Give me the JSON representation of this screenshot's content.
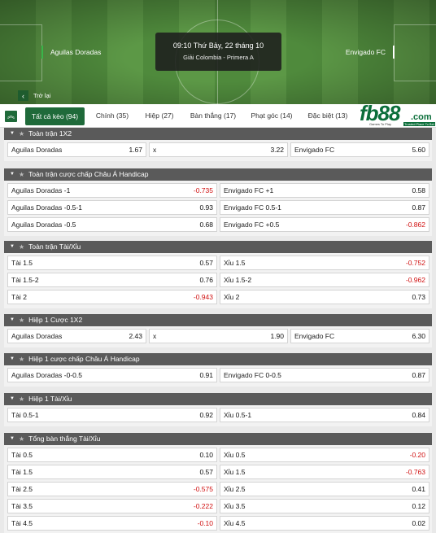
{
  "header": {
    "home_team": "Aguilas Doradas",
    "away_team": "Envigado FC",
    "time": "09:10 Thứ Bảy, 22 tháng 10",
    "league": "Giải Colombia - Primera A",
    "back_label": "Trở lại"
  },
  "tabs": [
    {
      "label": "Tất cả kèo (94)",
      "active": true
    },
    {
      "label": "Chính (35)"
    },
    {
      "label": "Hiệp (27)"
    },
    {
      "label": "Bàn thắng (17)"
    },
    {
      "label": "Phạt góc (14)"
    },
    {
      "label": "Đặc biệt (13)"
    }
  ],
  "logo": {
    "main": "fb88",
    "suffix": ".com",
    "tagline_left": "Games To Play",
    "tagline_right": "Trusted Place To Bet"
  },
  "markets": [
    {
      "title": "Toàn trận 1X2",
      "rows": [
        [
          {
            "name": "Aguilas Doradas",
            "line": "",
            "odds": "1.67"
          },
          {
            "name": "x",
            "line": "",
            "odds": "3.22"
          },
          {
            "name": "Envigado FC",
            "line": "",
            "odds": "5.60"
          }
        ]
      ]
    },
    {
      "title": "Toàn trận cược chấp Châu Á Handicap",
      "rows": [
        [
          {
            "name": "Aguilas Doradas",
            "line": "-1",
            "odds": "-0.735"
          },
          {
            "name": "Envigado FC",
            "line": "+1",
            "odds": "0.58"
          }
        ],
        [
          {
            "name": "Aguilas Doradas",
            "line": "-0.5-1",
            "odds": "0.93"
          },
          {
            "name": "Envigado FC",
            "line": "0.5-1",
            "odds": "0.87"
          }
        ],
        [
          {
            "name": "Aguilas Doradas",
            "line": "-0.5",
            "odds": "0.68"
          },
          {
            "name": "Envigado FC",
            "line": "+0.5",
            "odds": "-0.862"
          }
        ]
      ]
    },
    {
      "title": "Toàn trận Tài/Xỉu",
      "rows": [
        [
          {
            "name": "Tài",
            "line": "1.5",
            "odds": "0.57"
          },
          {
            "name": "Xỉu",
            "line": "1.5",
            "odds": "-0.752"
          }
        ],
        [
          {
            "name": "Tài",
            "line": "1.5-2",
            "odds": "0.76"
          },
          {
            "name": "Xỉu",
            "line": "1.5-2",
            "odds": "-0.962"
          }
        ],
        [
          {
            "name": "Tài",
            "line": "2",
            "odds": "-0.943"
          },
          {
            "name": "Xỉu",
            "line": "2",
            "odds": "0.73"
          }
        ]
      ]
    },
    {
      "title": "Hiệp 1 Cược 1X2",
      "rows": [
        [
          {
            "name": "Aguilas Doradas",
            "line": "",
            "odds": "2.43"
          },
          {
            "name": "x",
            "line": "",
            "odds": "1.90"
          },
          {
            "name": "Envigado FC",
            "line": "",
            "odds": "6.30"
          }
        ]
      ]
    },
    {
      "title": "Hiệp 1 cược chấp Châu Á Handicap",
      "rows": [
        [
          {
            "name": "Aguilas Doradas",
            "line": "-0-0.5",
            "odds": "0.91"
          },
          {
            "name": "Envigado FC",
            "line": "0-0.5",
            "odds": "0.87"
          }
        ]
      ]
    },
    {
      "title": "Hiệp 1 Tài/Xỉu",
      "rows": [
        [
          {
            "name": "Tài",
            "line": "0.5-1",
            "odds": "0.92"
          },
          {
            "name": "Xỉu",
            "line": "0.5-1",
            "odds": "0.84"
          }
        ]
      ]
    },
    {
      "title": "Tổng bàn thắng Tài/Xỉu",
      "rows": [
        [
          {
            "name": "Tài",
            "line": "0.5",
            "odds": "0.10"
          },
          {
            "name": "Xỉu",
            "line": "0.5",
            "odds": "-0.20"
          }
        ],
        [
          {
            "name": "Tài",
            "line": "1.5",
            "odds": "0.57"
          },
          {
            "name": "Xỉu",
            "line": "1.5",
            "odds": "-0.763"
          }
        ],
        [
          {
            "name": "Tài",
            "line": "2.5",
            "odds": "-0.575"
          },
          {
            "name": "Xỉu",
            "line": "2.5",
            "odds": "0.41"
          }
        ],
        [
          {
            "name": "Tài",
            "line": "3.5",
            "odds": "-0.222"
          },
          {
            "name": "Xỉu",
            "line": "3.5",
            "odds": "0.12"
          }
        ],
        [
          {
            "name": "Tài",
            "line": "4.5",
            "odds": "-0.10"
          },
          {
            "name": "Xỉu",
            "line": "4.5",
            "odds": "0.02"
          }
        ]
      ]
    }
  ],
  "colors": {
    "accent": "#1f6a3a",
    "negative_odds": "#d01010",
    "section_header": "#5a5a5a"
  },
  "icons": {
    "collapse_all": "double-chevron-up-icon",
    "section_toggle": "triangle-down-icon",
    "favorite": "star-icon",
    "back": "chevron-left-icon"
  }
}
